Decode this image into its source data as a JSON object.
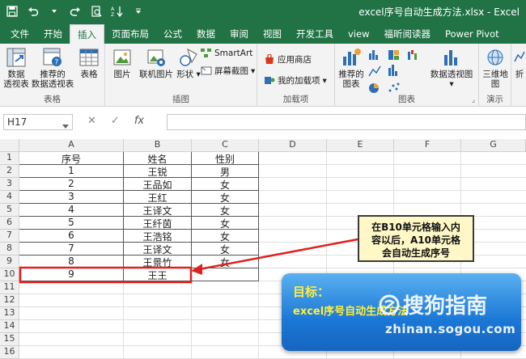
{
  "title_bar": {
    "title": "excel序号自动生成方法.xlsx - Excel"
  },
  "tabs": [
    {
      "label": "文件"
    },
    {
      "label": "开始"
    },
    {
      "label": "插入",
      "active": true
    },
    {
      "label": "页面布局"
    },
    {
      "label": "公式"
    },
    {
      "label": "数据"
    },
    {
      "label": "审阅"
    },
    {
      "label": "视图"
    },
    {
      "label": "开发工具"
    },
    {
      "label": "view"
    },
    {
      "label": "福昕阅读器"
    },
    {
      "label": "Power Pivot"
    }
  ],
  "ribbon": {
    "groups": {
      "tables": "表格",
      "illustrations": "插图",
      "addins": "加载项",
      "charts": "图表",
      "tours": "演示"
    },
    "buttons": {
      "pivot_l1": "数据",
      "pivot_l2": "透视表",
      "rec_pivot_l1": "推荐的",
      "rec_pivot_l2": "数据透视表",
      "table": "表格",
      "pictures": "图片",
      "online_pictures": "联机图片",
      "shapes": "形状",
      "smartart": "SmartArt",
      "screenshot": "屏幕截图",
      "store": "应用商店",
      "my_addins": "我的加载项",
      "rec_charts_l1": "推荐的",
      "rec_charts_l2": "图表",
      "pivot_chart": "数据透视图",
      "map3d_l1": "三维地",
      "map3d_l2": "图",
      "cut": "折"
    }
  },
  "formula_bar": {
    "name_box": "H17",
    "fx": "fx",
    "value": ""
  },
  "sheet": {
    "columns": [
      "A",
      "B",
      "C",
      "D",
      "E",
      "F",
      "G"
    ],
    "rows": [
      "1",
      "2",
      "3",
      "4",
      "5",
      "6",
      "7",
      "8",
      "9",
      "10",
      "11",
      "12",
      "13",
      "14",
      "15",
      "16"
    ],
    "cells": [
      [
        "序号",
        "姓名",
        "性别"
      ],
      [
        "1",
        "王锐",
        "男"
      ],
      [
        "2",
        "王品如",
        "女"
      ],
      [
        "3",
        "王红",
        "女"
      ],
      [
        "4",
        "王译文",
        "女"
      ],
      [
        "5",
        "王纤茵",
        "女"
      ],
      [
        "6",
        "王浩铭",
        "女"
      ],
      [
        "7",
        "王译文",
        "女"
      ],
      [
        "8",
        "王景竹",
        "女"
      ],
      [
        "9",
        "王王",
        ""
      ]
    ]
  },
  "callout": {
    "line1": "在B10单元格输入内",
    "line2": "容以后，A10单元格",
    "line3": "会自动生成序号"
  },
  "banner": {
    "heading": "目标：",
    "subtitle": "excel序号自动生成方法"
  },
  "watermark": {
    "main": "搜狗指南",
    "url": "zhinan.sogou.com"
  },
  "colors": {
    "excel_green": "#217346",
    "highlight_red": "#e02020",
    "callout_fill": "#fff8c6",
    "banner_blue": "#1b78d6",
    "banner_text": "#ffef3a"
  }
}
